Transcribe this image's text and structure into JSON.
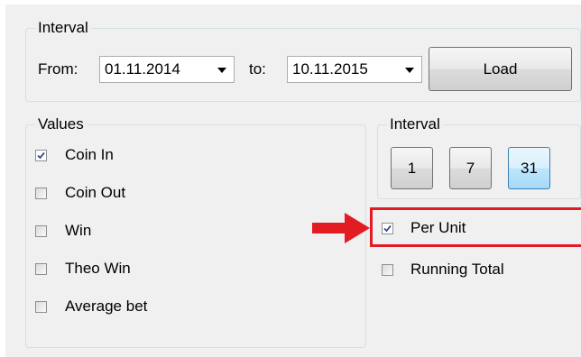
{
  "interval_range": {
    "legend": "Interval",
    "from_label": "From:",
    "from_value": "01.11.2014",
    "to_label": "to:",
    "to_value": "10.11.2015",
    "load_label": "Load"
  },
  "values": {
    "legend": "Values",
    "items": [
      {
        "label": "Coin In",
        "checked": true
      },
      {
        "label": "Coin Out",
        "checked": false
      },
      {
        "label": "Win",
        "checked": false
      },
      {
        "label": "Theo Win",
        "checked": false
      },
      {
        "label": "Average bet",
        "checked": false
      }
    ]
  },
  "interval_days": {
    "legend": "Interval",
    "options": [
      "1",
      "7",
      "31"
    ],
    "selected": "31"
  },
  "options": {
    "per_unit": {
      "label": "Per Unit",
      "checked": true
    },
    "running_total": {
      "label": "Running Total",
      "checked": false
    }
  },
  "colors": {
    "highlight": "#e31b23",
    "check_mark": "#3a4a8a"
  },
  "annotation": {
    "icon": "red-arrow-right-icon"
  }
}
